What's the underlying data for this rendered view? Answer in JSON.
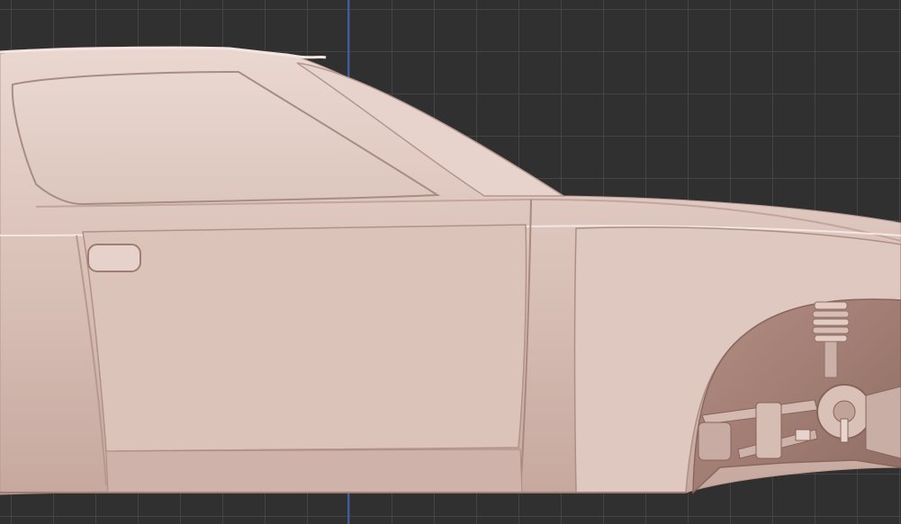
{
  "viewport": {
    "background_color": "#303030",
    "grid_color": "#464646",
    "axis_color": "#3c63b8",
    "model_color": "#e3cbc3"
  },
  "model": {
    "parts": [
      "car-body",
      "side-window",
      "windshield",
      "door-panel",
      "door-handle",
      "front-fender",
      "wheel-arch",
      "suspension-assembly"
    ]
  }
}
